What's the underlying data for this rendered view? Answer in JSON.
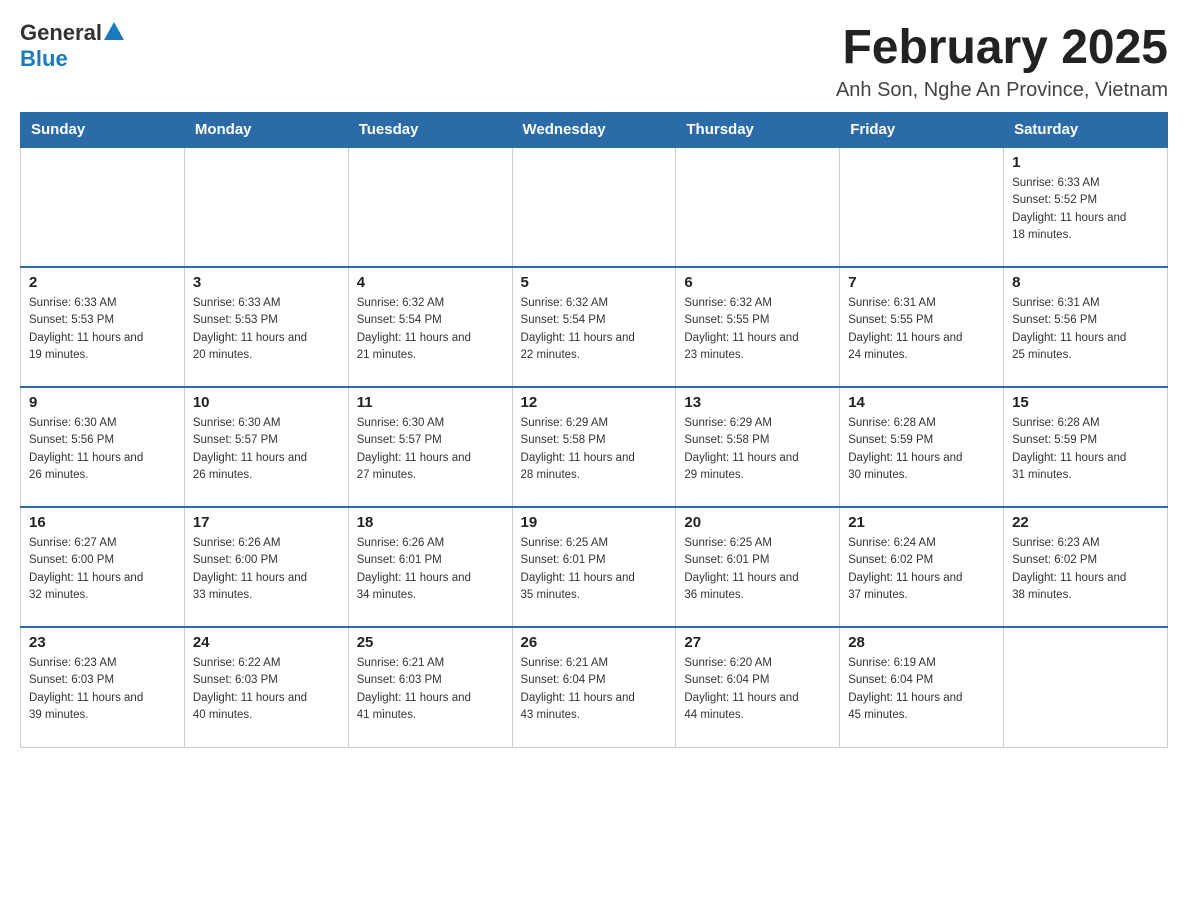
{
  "header": {
    "logo_general": "General",
    "logo_blue": "Blue",
    "month_title": "February 2025",
    "location": "Anh Son, Nghe An Province, Vietnam"
  },
  "days_of_week": [
    "Sunday",
    "Monday",
    "Tuesday",
    "Wednesday",
    "Thursday",
    "Friday",
    "Saturday"
  ],
  "weeks": [
    {
      "days": [
        {
          "number": "",
          "sunrise": "",
          "sunset": "",
          "daylight": ""
        },
        {
          "number": "",
          "sunrise": "",
          "sunset": "",
          "daylight": ""
        },
        {
          "number": "",
          "sunrise": "",
          "sunset": "",
          "daylight": ""
        },
        {
          "number": "",
          "sunrise": "",
          "sunset": "",
          "daylight": ""
        },
        {
          "number": "",
          "sunrise": "",
          "sunset": "",
          "daylight": ""
        },
        {
          "number": "",
          "sunrise": "",
          "sunset": "",
          "daylight": ""
        },
        {
          "number": "1",
          "sunrise": "Sunrise: 6:33 AM",
          "sunset": "Sunset: 5:52 PM",
          "daylight": "Daylight: 11 hours and 18 minutes."
        }
      ]
    },
    {
      "days": [
        {
          "number": "2",
          "sunrise": "Sunrise: 6:33 AM",
          "sunset": "Sunset: 5:53 PM",
          "daylight": "Daylight: 11 hours and 19 minutes."
        },
        {
          "number": "3",
          "sunrise": "Sunrise: 6:33 AM",
          "sunset": "Sunset: 5:53 PM",
          "daylight": "Daylight: 11 hours and 20 minutes."
        },
        {
          "number": "4",
          "sunrise": "Sunrise: 6:32 AM",
          "sunset": "Sunset: 5:54 PM",
          "daylight": "Daylight: 11 hours and 21 minutes."
        },
        {
          "number": "5",
          "sunrise": "Sunrise: 6:32 AM",
          "sunset": "Sunset: 5:54 PM",
          "daylight": "Daylight: 11 hours and 22 minutes."
        },
        {
          "number": "6",
          "sunrise": "Sunrise: 6:32 AM",
          "sunset": "Sunset: 5:55 PM",
          "daylight": "Daylight: 11 hours and 23 minutes."
        },
        {
          "number": "7",
          "sunrise": "Sunrise: 6:31 AM",
          "sunset": "Sunset: 5:55 PM",
          "daylight": "Daylight: 11 hours and 24 minutes."
        },
        {
          "number": "8",
          "sunrise": "Sunrise: 6:31 AM",
          "sunset": "Sunset: 5:56 PM",
          "daylight": "Daylight: 11 hours and 25 minutes."
        }
      ]
    },
    {
      "days": [
        {
          "number": "9",
          "sunrise": "Sunrise: 6:30 AM",
          "sunset": "Sunset: 5:56 PM",
          "daylight": "Daylight: 11 hours and 26 minutes."
        },
        {
          "number": "10",
          "sunrise": "Sunrise: 6:30 AM",
          "sunset": "Sunset: 5:57 PM",
          "daylight": "Daylight: 11 hours and 26 minutes."
        },
        {
          "number": "11",
          "sunrise": "Sunrise: 6:30 AM",
          "sunset": "Sunset: 5:57 PM",
          "daylight": "Daylight: 11 hours and 27 minutes."
        },
        {
          "number": "12",
          "sunrise": "Sunrise: 6:29 AM",
          "sunset": "Sunset: 5:58 PM",
          "daylight": "Daylight: 11 hours and 28 minutes."
        },
        {
          "number": "13",
          "sunrise": "Sunrise: 6:29 AM",
          "sunset": "Sunset: 5:58 PM",
          "daylight": "Daylight: 11 hours and 29 minutes."
        },
        {
          "number": "14",
          "sunrise": "Sunrise: 6:28 AM",
          "sunset": "Sunset: 5:59 PM",
          "daylight": "Daylight: 11 hours and 30 minutes."
        },
        {
          "number": "15",
          "sunrise": "Sunrise: 6:28 AM",
          "sunset": "Sunset: 5:59 PM",
          "daylight": "Daylight: 11 hours and 31 minutes."
        }
      ]
    },
    {
      "days": [
        {
          "number": "16",
          "sunrise": "Sunrise: 6:27 AM",
          "sunset": "Sunset: 6:00 PM",
          "daylight": "Daylight: 11 hours and 32 minutes."
        },
        {
          "number": "17",
          "sunrise": "Sunrise: 6:26 AM",
          "sunset": "Sunset: 6:00 PM",
          "daylight": "Daylight: 11 hours and 33 minutes."
        },
        {
          "number": "18",
          "sunrise": "Sunrise: 6:26 AM",
          "sunset": "Sunset: 6:01 PM",
          "daylight": "Daylight: 11 hours and 34 minutes."
        },
        {
          "number": "19",
          "sunrise": "Sunrise: 6:25 AM",
          "sunset": "Sunset: 6:01 PM",
          "daylight": "Daylight: 11 hours and 35 minutes."
        },
        {
          "number": "20",
          "sunrise": "Sunrise: 6:25 AM",
          "sunset": "Sunset: 6:01 PM",
          "daylight": "Daylight: 11 hours and 36 minutes."
        },
        {
          "number": "21",
          "sunrise": "Sunrise: 6:24 AM",
          "sunset": "Sunset: 6:02 PM",
          "daylight": "Daylight: 11 hours and 37 minutes."
        },
        {
          "number": "22",
          "sunrise": "Sunrise: 6:23 AM",
          "sunset": "Sunset: 6:02 PM",
          "daylight": "Daylight: 11 hours and 38 minutes."
        }
      ]
    },
    {
      "days": [
        {
          "number": "23",
          "sunrise": "Sunrise: 6:23 AM",
          "sunset": "Sunset: 6:03 PM",
          "daylight": "Daylight: 11 hours and 39 minutes."
        },
        {
          "number": "24",
          "sunrise": "Sunrise: 6:22 AM",
          "sunset": "Sunset: 6:03 PM",
          "daylight": "Daylight: 11 hours and 40 minutes."
        },
        {
          "number": "25",
          "sunrise": "Sunrise: 6:21 AM",
          "sunset": "Sunset: 6:03 PM",
          "daylight": "Daylight: 11 hours and 41 minutes."
        },
        {
          "number": "26",
          "sunrise": "Sunrise: 6:21 AM",
          "sunset": "Sunset: 6:04 PM",
          "daylight": "Daylight: 11 hours and 43 minutes."
        },
        {
          "number": "27",
          "sunrise": "Sunrise: 6:20 AM",
          "sunset": "Sunset: 6:04 PM",
          "daylight": "Daylight: 11 hours and 44 minutes."
        },
        {
          "number": "28",
          "sunrise": "Sunrise: 6:19 AM",
          "sunset": "Sunset: 6:04 PM",
          "daylight": "Daylight: 11 hours and 45 minutes."
        },
        {
          "number": "",
          "sunrise": "",
          "sunset": "",
          "daylight": ""
        }
      ]
    }
  ]
}
